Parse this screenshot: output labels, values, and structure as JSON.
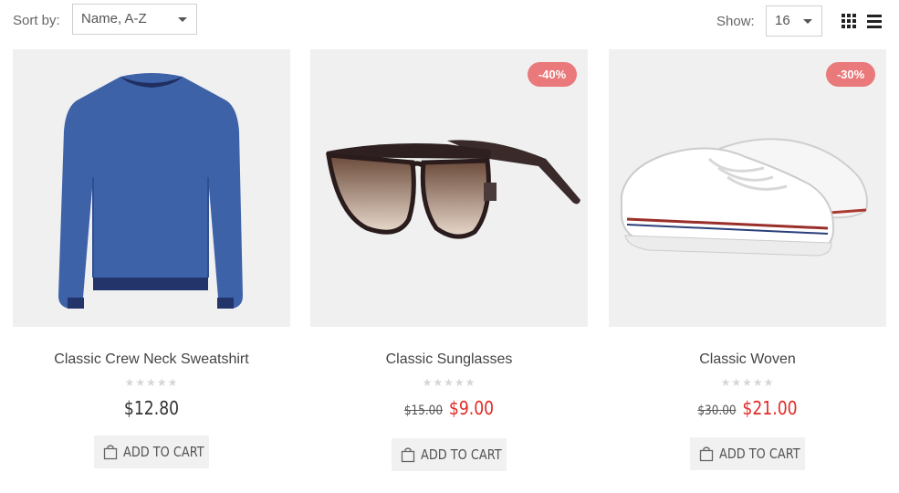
{
  "toolbar": {
    "sort_label": "Sort by:",
    "sort_value": "Name, A-Z",
    "show_label": "Show:",
    "show_value": "16"
  },
  "products": [
    {
      "title": "Classic Crew Neck Sweatshirt",
      "price": "$12.80",
      "old_price": "",
      "new_price": "",
      "discount": "",
      "rating": 0,
      "cart_label": "ADD TO CART",
      "image_icon": "sweatshirt-image"
    },
    {
      "title": "Classic Sunglasses",
      "price": "",
      "old_price": "$15.00",
      "new_price": "$9.00",
      "discount": "-40%",
      "rating": 0,
      "cart_label": "ADD TO CART",
      "image_icon": "sunglasses-image"
    },
    {
      "title": "Classic Woven",
      "price": "",
      "old_price": "$30.00",
      "new_price": "$21.00",
      "discount": "-30%",
      "rating": 0,
      "cart_label": "ADD TO CART",
      "image_icon": "sneakers-image"
    }
  ],
  "colors": {
    "badge": "#e9797a",
    "sale_price": "#e02b27",
    "image_bg": "#f0f0f0"
  }
}
